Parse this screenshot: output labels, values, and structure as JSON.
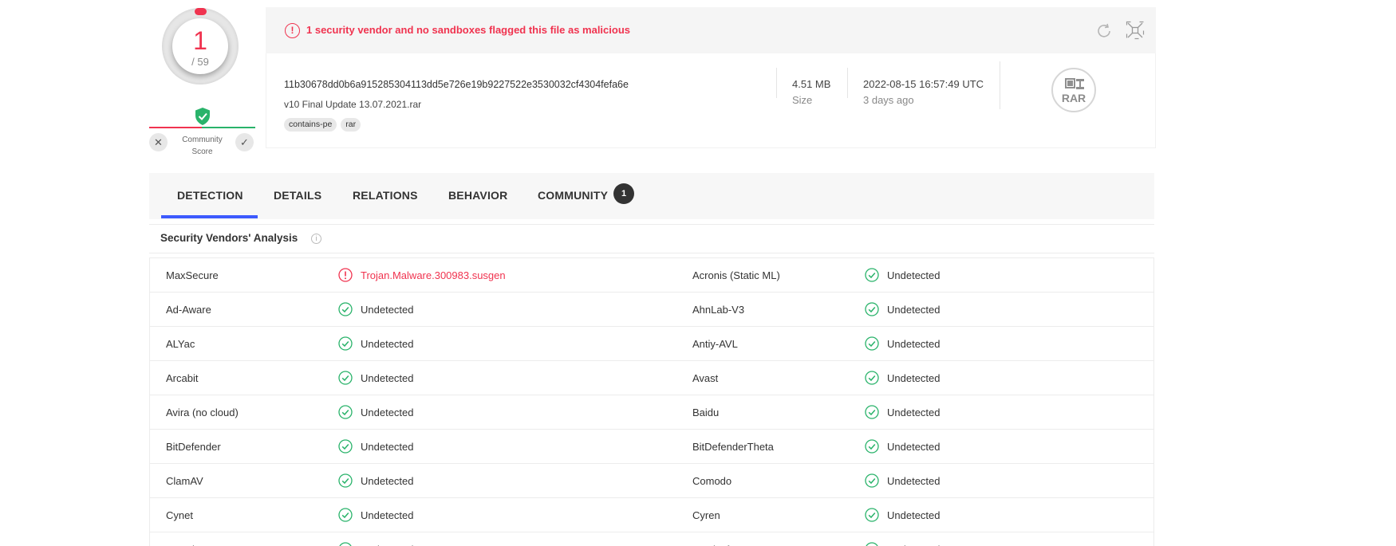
{
  "score": {
    "value": "1",
    "total": "/ 59"
  },
  "community": {
    "label": "Community Score"
  },
  "alert": {
    "text": "1 security vendor and no sandboxes flagged this file as malicious"
  },
  "file": {
    "hash": "11b30678dd0b6a915285304113dd5e726e19b9227522e3530032cf4304fefa6e",
    "name": "v10 Final Update 13.07.2021.rar",
    "tags": [
      "contains-pe",
      "rar"
    ],
    "size_value": "4.51 MB",
    "size_label": "Size",
    "date_value": "2022-08-15 16:57:49 UTC",
    "date_relative": "3 days ago",
    "type_label": "RAR"
  },
  "tabs": [
    {
      "label": "DETECTION"
    },
    {
      "label": "DETAILS"
    },
    {
      "label": "RELATIONS"
    },
    {
      "label": "BEHAVIOR"
    },
    {
      "label": "COMMUNITY",
      "badge": "1"
    }
  ],
  "section": {
    "title": "Security Vendors' Analysis"
  },
  "vendors": [
    {
      "left": {
        "name": "MaxSecure",
        "result": "Trojan.Malware.300983.susgen",
        "malicious": true
      },
      "right": {
        "name": "Acronis (Static ML)",
        "result": "Undetected",
        "malicious": false
      }
    },
    {
      "left": {
        "name": "Ad-Aware",
        "result": "Undetected",
        "malicious": false
      },
      "right": {
        "name": "AhnLab-V3",
        "result": "Undetected",
        "malicious": false
      }
    },
    {
      "left": {
        "name": "ALYac",
        "result": "Undetected",
        "malicious": false
      },
      "right": {
        "name": "Antiy-AVL",
        "result": "Undetected",
        "malicious": false
      }
    },
    {
      "left": {
        "name": "Arcabit",
        "result": "Undetected",
        "malicious": false
      },
      "right": {
        "name": "Avast",
        "result": "Undetected",
        "malicious": false
      }
    },
    {
      "left": {
        "name": "Avira (no cloud)",
        "result": "Undetected",
        "malicious": false
      },
      "right": {
        "name": "Baidu",
        "result": "Undetected",
        "malicious": false
      }
    },
    {
      "left": {
        "name": "BitDefender",
        "result": "Undetected",
        "malicious": false
      },
      "right": {
        "name": "BitDefenderTheta",
        "result": "Undetected",
        "malicious": false
      }
    },
    {
      "left": {
        "name": "ClamAV",
        "result": "Undetected",
        "malicious": false
      },
      "right": {
        "name": "Comodo",
        "result": "Undetected",
        "malicious": false
      }
    },
    {
      "left": {
        "name": "Cynet",
        "result": "Undetected",
        "malicious": false
      },
      "right": {
        "name": "Cyren",
        "result": "Undetected",
        "malicious": false
      }
    },
    {
      "left": {
        "name": "DrWeb",
        "result": "Undetected",
        "malicious": false
      },
      "right": {
        "name": "Emsisoft",
        "result": "Undetected",
        "malicious": false
      }
    }
  ],
  "colors": {
    "malicious": "#f0334f",
    "clean": "#29b36a",
    "accent": "#3d5afe"
  }
}
